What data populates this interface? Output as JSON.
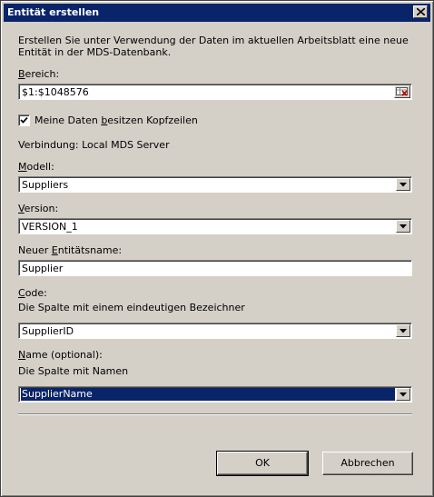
{
  "window": {
    "title": "Entität erstellen"
  },
  "description": "Erstellen Sie unter Verwendung der Daten im aktuellen Arbeitsblatt eine neue Entität in der MDS-Datenbank.",
  "range": {
    "label_u": "B",
    "label_rest": "ereich:",
    "value": "$1:$1048576"
  },
  "headers_checkbox": {
    "label_pre": "Meine Daten ",
    "label_u": "b",
    "label_post": "esitzen Kopfzeilen",
    "checked": true
  },
  "connection": {
    "text": "Verbindung: Local MDS Server"
  },
  "model": {
    "label_u": "M",
    "label_rest": "odell:",
    "selected": "Suppliers"
  },
  "version": {
    "label_u": "V",
    "label_rest": "ersion:",
    "selected": "VERSION_1"
  },
  "entity_name": {
    "label_pre": "Neuer ",
    "label_u": "E",
    "label_post": "ntitätsname:",
    "value": "Supplier"
  },
  "code": {
    "label_u": "C",
    "label_rest": "ode:",
    "hint": "Die Spalte mit einem eindeutigen Bezeichner",
    "selected": "SupplierID"
  },
  "name": {
    "label_u": "N",
    "label_rest": "ame (optional):",
    "hint": "Die Spalte mit Namen",
    "selected": "SupplierName"
  },
  "buttons": {
    "ok": "OK",
    "cancel": "Abbrechen"
  }
}
